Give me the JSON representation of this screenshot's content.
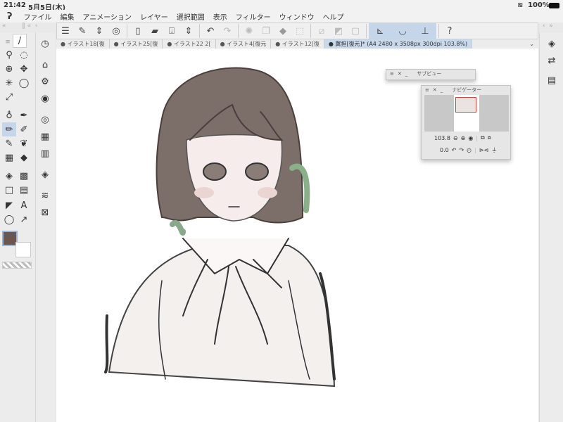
{
  "status": {
    "time": "21:42",
    "date": "5月5日(木)",
    "battery": "100%"
  },
  "menu": {
    "items": [
      "ファイル",
      "編集",
      "アニメーション",
      "レイヤー",
      "選択範囲",
      "表示",
      "フィルター",
      "ウィンドウ",
      "ヘルプ"
    ]
  },
  "tabs": [
    "● イラスト18[復",
    "● イラスト25[復",
    "● イラスト22 2[",
    "● イラスト4[復元",
    "● イラスト12[復",
    "● 翼担[復元]* (A4 2480 x 3508px 300dpi 103.8%)"
  ],
  "subview": {
    "title": "サブビュー"
  },
  "navigator": {
    "title": "ナビゲーター",
    "zoom": "103.8",
    "rotation": "0.0"
  },
  "colors": {
    "main": "#6b5650",
    "sub": "#ffffff",
    "accent": "#c6d6ea"
  }
}
